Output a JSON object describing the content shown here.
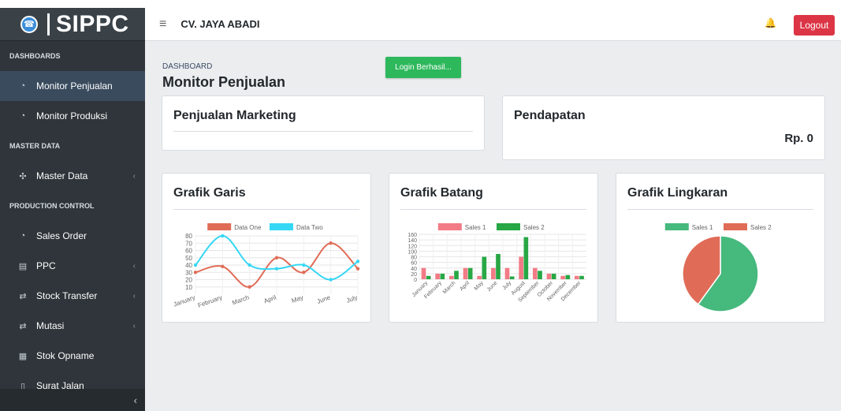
{
  "brand": {
    "name": "SIPPC",
    "logo_icon": "logo-icon"
  },
  "sidebar": {
    "sections": [
      {
        "title": "DASHBOARDS",
        "items": [
          {
            "label": "Monitor Penjualan",
            "icon": "speedometer-icon",
            "active": true
          },
          {
            "label": "Monitor Produksi",
            "icon": "speedometer-icon"
          }
        ]
      },
      {
        "title": "MASTER DATA",
        "items": [
          {
            "label": "Master Data",
            "icon": "puzzle-icon",
            "caret": true
          }
        ]
      },
      {
        "title": "PRODUCTION CONTROL",
        "items": [
          {
            "label": "Sales Order",
            "icon": "speedometer-icon"
          },
          {
            "label": "PPC",
            "icon": "document-icon",
            "caret": true
          },
          {
            "label": "Stock Transfer",
            "icon": "transfer-icon",
            "caret": true
          },
          {
            "label": "Mutasi",
            "icon": "transfer-icon",
            "caret": true
          },
          {
            "label": "Stok Opname",
            "icon": "spreadsheet-icon"
          },
          {
            "label": "Surat Jalan",
            "icon": "file-icon"
          }
        ]
      }
    ],
    "toggle_icon": "chevron-left-icon"
  },
  "header": {
    "company": "CV. JAYA ABADI",
    "logout_label": "Logout"
  },
  "page": {
    "breadcrumb": "DASHBOARD",
    "title": "Monitor Penjualan",
    "toast": "Login Berhasil..."
  },
  "cards": {
    "penjualan": {
      "title": "Penjualan Marketing"
    },
    "pendapatan": {
      "title": "Pendapatan",
      "amount": "Rp. 0"
    },
    "garis": {
      "title": "Grafik Garis"
    },
    "batang": {
      "title": "Grafik Batang"
    },
    "lingkaran": {
      "title": "Grafik Lingkaran"
    }
  },
  "colors": {
    "red": "#e06c57",
    "cyan": "#36d7f5",
    "pink": "#f27b86",
    "green": "#28a745",
    "pieGreen": "#46b97d",
    "pieRed": "#e06c57",
    "sidebar": "#2f353a",
    "logout": "#dc3545",
    "toast": "#2eb85c"
  },
  "chart_data": [
    {
      "type": "line",
      "title": "Grafik Garis",
      "categories": [
        "January",
        "February",
        "March",
        "April",
        "May",
        "June",
        "July"
      ],
      "series": [
        {
          "name": "Data One",
          "values": [
            30,
            38,
            10,
            50,
            30,
            70,
            35
          ]
        },
        {
          "name": "Data Two",
          "values": [
            40,
            80,
            40,
            35,
            40,
            20,
            45
          ]
        }
      ],
      "ylim": [
        0,
        80
      ],
      "yticks": [
        10,
        20,
        30,
        40,
        50,
        60,
        70,
        80
      ],
      "legend": "top"
    },
    {
      "type": "bar",
      "title": "Grafik Batang",
      "categories": [
        "January",
        "February",
        "March",
        "April",
        "May",
        "June",
        "July",
        "August",
        "September",
        "October",
        "November",
        "December"
      ],
      "series": [
        {
          "name": "Sales 1",
          "values": [
            40,
            20,
            12,
            40,
            12,
            40,
            40,
            80,
            40,
            20,
            12,
            12
          ]
        },
        {
          "name": "Sales 2",
          "values": [
            12,
            20,
            30,
            40,
            80,
            90,
            10,
            150,
            30,
            20,
            15,
            12
          ]
        }
      ],
      "ylim": [
        0,
        160
      ],
      "yticks": [
        0,
        20,
        40,
        60,
        80,
        100,
        120,
        140,
        160
      ],
      "legend": "top"
    },
    {
      "type": "pie",
      "title": "Grafik Lingkaran",
      "labels": [
        "Sales 1",
        "Sales 2"
      ],
      "values": [
        60,
        40
      ],
      "legend": "top"
    }
  ]
}
